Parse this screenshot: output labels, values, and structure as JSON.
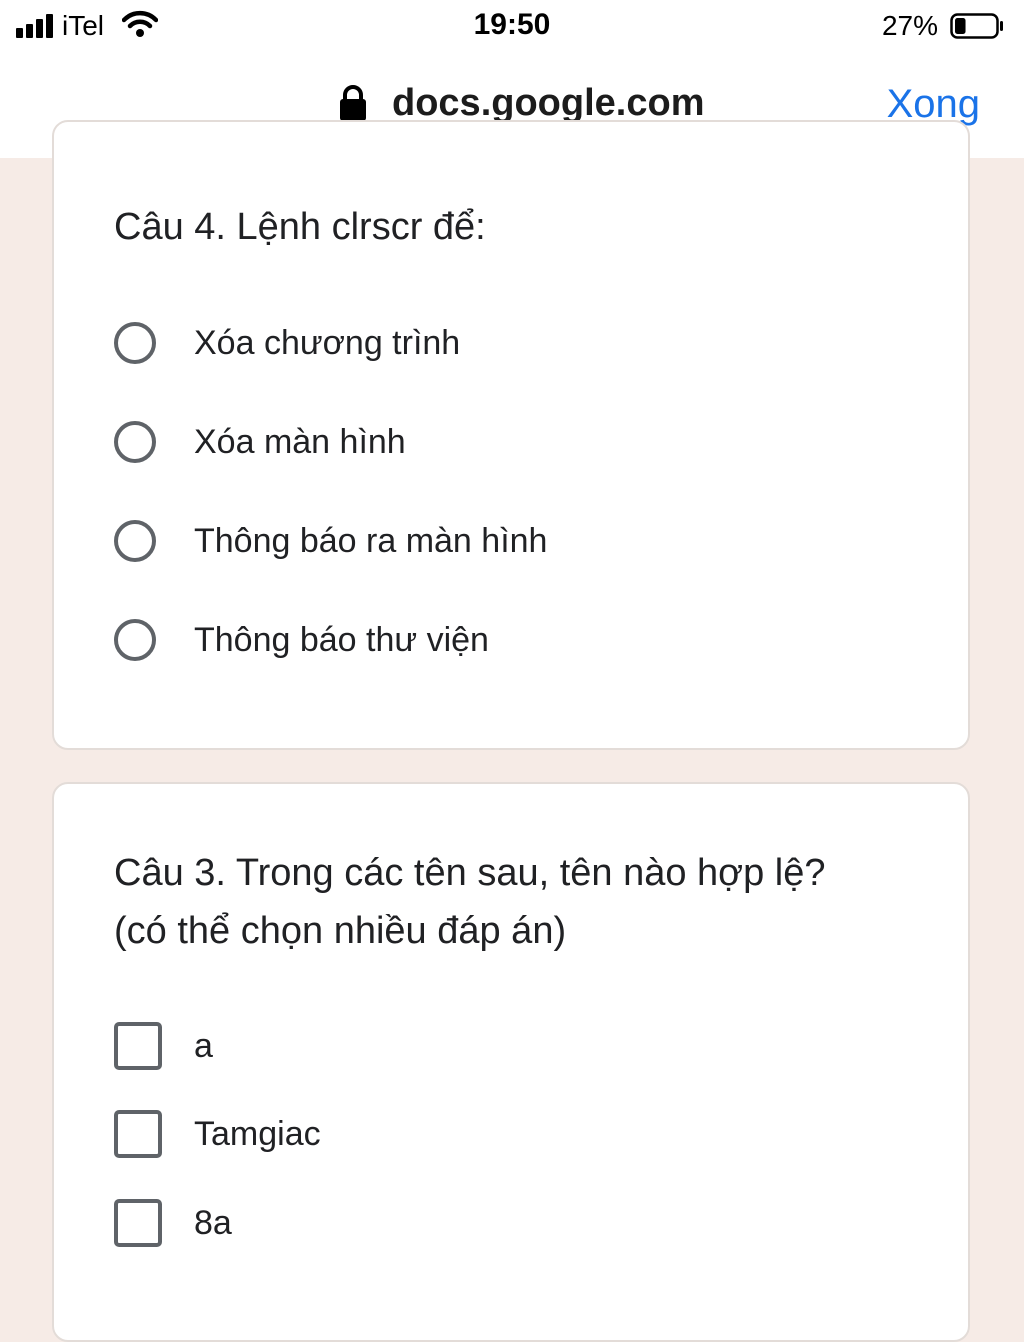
{
  "status_bar": {
    "carrier": "iTel",
    "time": "19:50",
    "battery_percent": "27%",
    "battery_level": 0.27
  },
  "browser": {
    "url": "docs.google.com",
    "done_label": "Xong"
  },
  "questions": [
    {
      "title": "Câu 4. Lệnh clrscr để:",
      "type": "radio",
      "options": [
        "Xóa chương trình",
        "Xóa màn hình",
        "Thông báo ra màn hình",
        "Thông báo thư viện"
      ]
    },
    {
      "title_line1": "Câu 3. Trong các tên sau, tên nào hợp lệ?",
      "title_line2": "(có thể chọn nhiều đáp án)",
      "type": "checkbox",
      "options": [
        "a",
        "Tamgiac",
        "8a"
      ]
    }
  ],
  "icons": {
    "signal": "signal-bars-icon",
    "wifi": "wifi-icon",
    "battery": "battery-icon",
    "lock": "lock-icon",
    "radio": "radio-button-icon",
    "checkbox": "checkbox-icon"
  },
  "colors": {
    "page_background": "#f6ebe6",
    "link_blue": "#1a73e8",
    "control_gray": "#5f6368"
  }
}
